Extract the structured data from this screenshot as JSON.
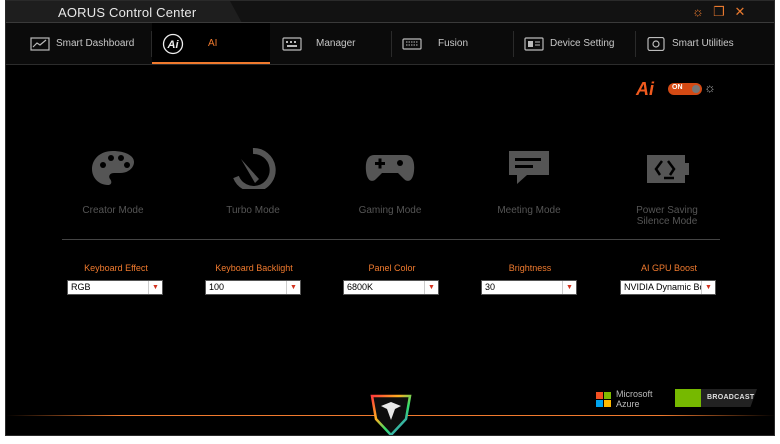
{
  "app": {
    "title": "AORUS Control Center"
  },
  "window_controls": {
    "settings_icon": "gear-icon",
    "restore_icon": "restore-icon",
    "close_icon": "close-icon"
  },
  "tabs": [
    {
      "label": "Smart Dashboard",
      "icon": "dashboard-icon",
      "active": false
    },
    {
      "label": "AI",
      "icon": "ai-icon",
      "active": true
    },
    {
      "label": "Manager",
      "icon": "manager-icon",
      "active": false
    },
    {
      "label": "Fusion",
      "icon": "keyboard-icon",
      "active": false
    },
    {
      "label": "Device Setting",
      "icon": "device-icon",
      "active": false
    },
    {
      "label": "Smart Utilities",
      "icon": "utilities-icon",
      "active": false
    }
  ],
  "ai_toggle": {
    "logo": "Ai",
    "state_label": "ON",
    "enabled": true
  },
  "modes": [
    {
      "label": "Creator Mode",
      "icon": "palette-icon"
    },
    {
      "label": "Turbo Mode",
      "icon": "speedometer-icon"
    },
    {
      "label": "Gaming Mode",
      "icon": "gamepad-icon"
    },
    {
      "label": "Meeting Mode",
      "icon": "chat-icon"
    },
    {
      "label": "Power Saving Silence Mode",
      "label_line1": "Power Saving",
      "label_line2": "Silence Mode",
      "icon": "battery-recycle-icon"
    }
  ],
  "settings": [
    {
      "label": "Keyboard Effect",
      "value": "RGB"
    },
    {
      "label": "Keyboard Backlight",
      "value": "100"
    },
    {
      "label": "Panel Color",
      "value": "6800K"
    },
    {
      "label": "Brightness",
      "value": "30"
    },
    {
      "label": "AI GPU Boost",
      "value": "NVIDIA Dynamic Bo"
    }
  ],
  "partners": {
    "microsoft_line1": "Microsoft",
    "microsoft_line2": "Azure",
    "nvidia": "BROADCAST"
  },
  "colors": {
    "accent": "#f07a2e",
    "ai_red": "#f05a1e",
    "background": "#000000",
    "mode_gray": "#555555"
  }
}
